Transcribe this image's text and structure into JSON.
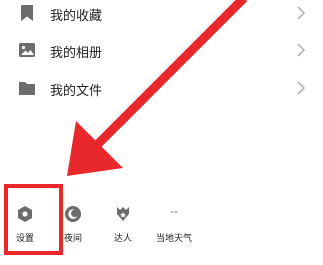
{
  "menu": {
    "items": [
      {
        "label": "我的收藏",
        "icon": "bookmark-icon"
      },
      {
        "label": "我的相册",
        "icon": "image-icon"
      },
      {
        "label": "我的文件",
        "icon": "folder-icon"
      }
    ]
  },
  "bottom_bar": {
    "items": [
      {
        "label": "设置",
        "icon": "settings-hexagon-icon"
      },
      {
        "label": "夜间",
        "icon": "moon-icon"
      },
      {
        "label": "达人",
        "icon": "badge-icon"
      },
      {
        "label": "当地天气",
        "icon": "weather-placeholder-icon",
        "icon_text": "--"
      }
    ]
  },
  "colors": {
    "annotation_red": "#e8282b",
    "icon_gray": "#6c6c6c",
    "chevron_gray": "#b5b5b5"
  }
}
